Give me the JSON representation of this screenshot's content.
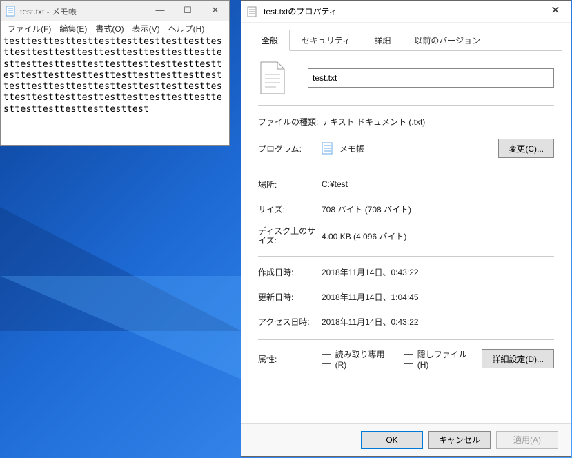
{
  "notepad": {
    "title": "test.txt - メモ帳",
    "menu": {
      "file": "ファイル(F)",
      "edit": "編集(E)",
      "format": "書式(O)",
      "view": "表示(V)",
      "help": "ヘルプ(H)"
    },
    "content": "testtesttesttesttesttesttesttesttesttesttesttesttesttesttesttesttesttesttesttesttesttesttesttesttesttesttesttesttesttesttesttesttesttesttesttesttesttesttesttesttesttesttesttesttesttesttesttesttesttesttesttesttesttesttesttesttesttesttesttesttesttesttesttesttest"
  },
  "props": {
    "title": "test.txtのプロパティ",
    "tabs": {
      "general": "全般",
      "security": "セキュリティ",
      "details": "詳細",
      "previous": "以前のバージョン"
    },
    "filename": "test.txt",
    "labels": {
      "type": "ファイルの種類:",
      "program": "プログラム:",
      "location": "場所:",
      "size": "サイズ:",
      "disk_size": "ディスク上のサイズ:",
      "created": "作成日時:",
      "modified": "更新日時:",
      "accessed": "アクセス日時:",
      "attributes": "属性:"
    },
    "values": {
      "type": "テキスト ドキュメント (.txt)",
      "program": "メモ帳",
      "location": "C:¥test",
      "size": "708 バイト (708 バイト)",
      "disk_size": "4.00 KB (4,096 バイト)",
      "created": "2018年11月14日、0:43:22",
      "modified": "2018年11月14日、1:04:45",
      "accessed": "2018年11月14日、0:43:22"
    },
    "attr_readonly": "読み取り専用(R)",
    "attr_hidden": "隠しファイル(H)",
    "change_btn": "変更(C)...",
    "advanced_btn": "詳細設定(D)...",
    "footer": {
      "ok": "OK",
      "cancel": "キャンセル",
      "apply": "適用(A)"
    }
  }
}
